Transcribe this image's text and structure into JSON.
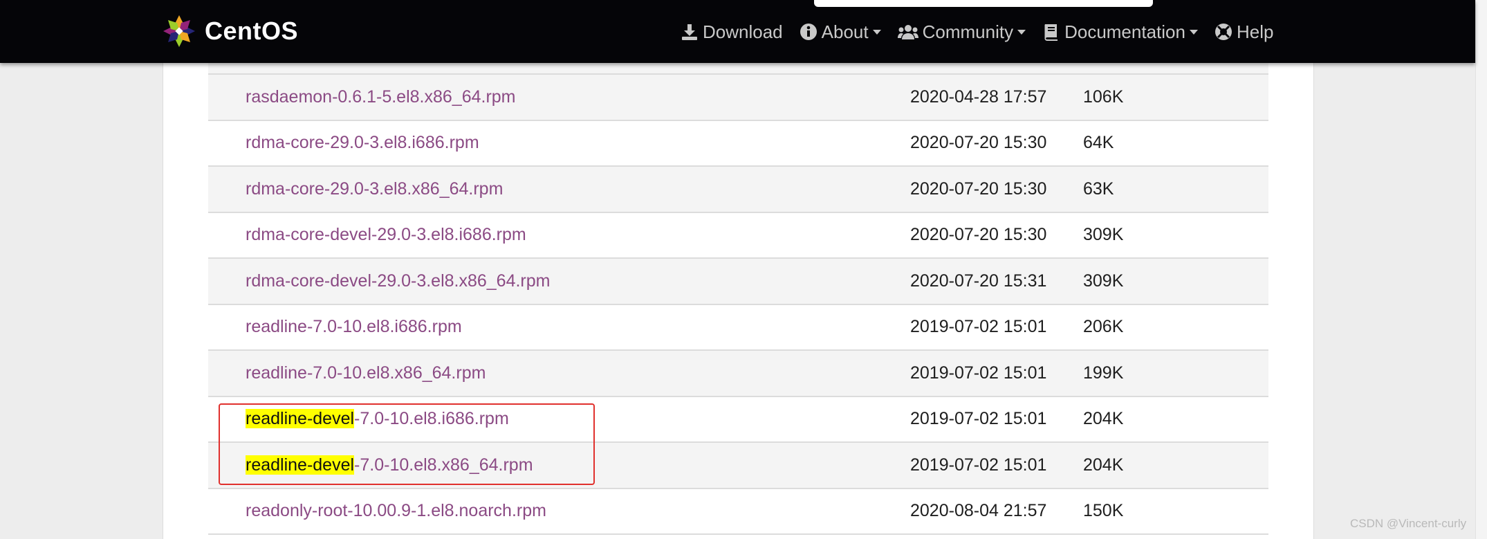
{
  "navbar": {
    "brand": "CentOS",
    "items": [
      {
        "label": "Download",
        "icon": "download-icon",
        "dropdown": false
      },
      {
        "label": "About",
        "icon": "info-circle-icon",
        "dropdown": true
      },
      {
        "label": "Community",
        "icon": "users-icon",
        "dropdown": true
      },
      {
        "label": "Documentation",
        "icon": "book-icon",
        "dropdown": true
      },
      {
        "label": "Help",
        "icon": "lifebuoy-icon",
        "dropdown": false
      }
    ]
  },
  "files": [
    {
      "prefix": "",
      "highlight": "",
      "name": "rasdaemon-0.6.1-5.el8.x86_64.rpm",
      "date": "2020-04-28 17:57",
      "size": "106K"
    },
    {
      "prefix": "",
      "highlight": "",
      "name": "rdma-core-29.0-3.el8.i686.rpm",
      "date": "2020-07-20 15:30",
      "size": "64K"
    },
    {
      "prefix": "",
      "highlight": "",
      "name": "rdma-core-29.0-3.el8.x86_64.rpm",
      "date": "2020-07-20 15:30",
      "size": "63K"
    },
    {
      "prefix": "",
      "highlight": "",
      "name": "rdma-core-devel-29.0-3.el8.i686.rpm",
      "date": "2020-07-20 15:30",
      "size": "309K"
    },
    {
      "prefix": "",
      "highlight": "",
      "name": "rdma-core-devel-29.0-3.el8.x86_64.rpm",
      "date": "2020-07-20 15:31",
      "size": "309K"
    },
    {
      "prefix": "",
      "highlight": "",
      "name": "readline-7.0-10.el8.i686.rpm",
      "date": "2019-07-02 15:01",
      "size": "206K"
    },
    {
      "prefix": "",
      "highlight": "",
      "name": "readline-7.0-10.el8.x86_64.rpm",
      "date": "2019-07-02 15:01",
      "size": "199K"
    },
    {
      "prefix": "",
      "highlight": "readline-devel",
      "name": "-7.0-10.el8.i686.rpm",
      "date": "2019-07-02 15:01",
      "size": "204K"
    },
    {
      "prefix": "",
      "highlight": "readline-devel",
      "name": "-7.0-10.el8.x86_64.rpm",
      "date": "2019-07-02 15:01",
      "size": "204K"
    },
    {
      "prefix": "",
      "highlight": "",
      "name": "readonly-root-10.00.9-1.el8.noarch.rpm",
      "date": "2020-08-04 21:57",
      "size": "150K"
    }
  ],
  "watermark": "CSDN @Vincent-curly",
  "colors": {
    "link": "#8b4a84",
    "highlight": "#ffff00",
    "annotation": "#e0302d",
    "navbar": "#050508"
  }
}
